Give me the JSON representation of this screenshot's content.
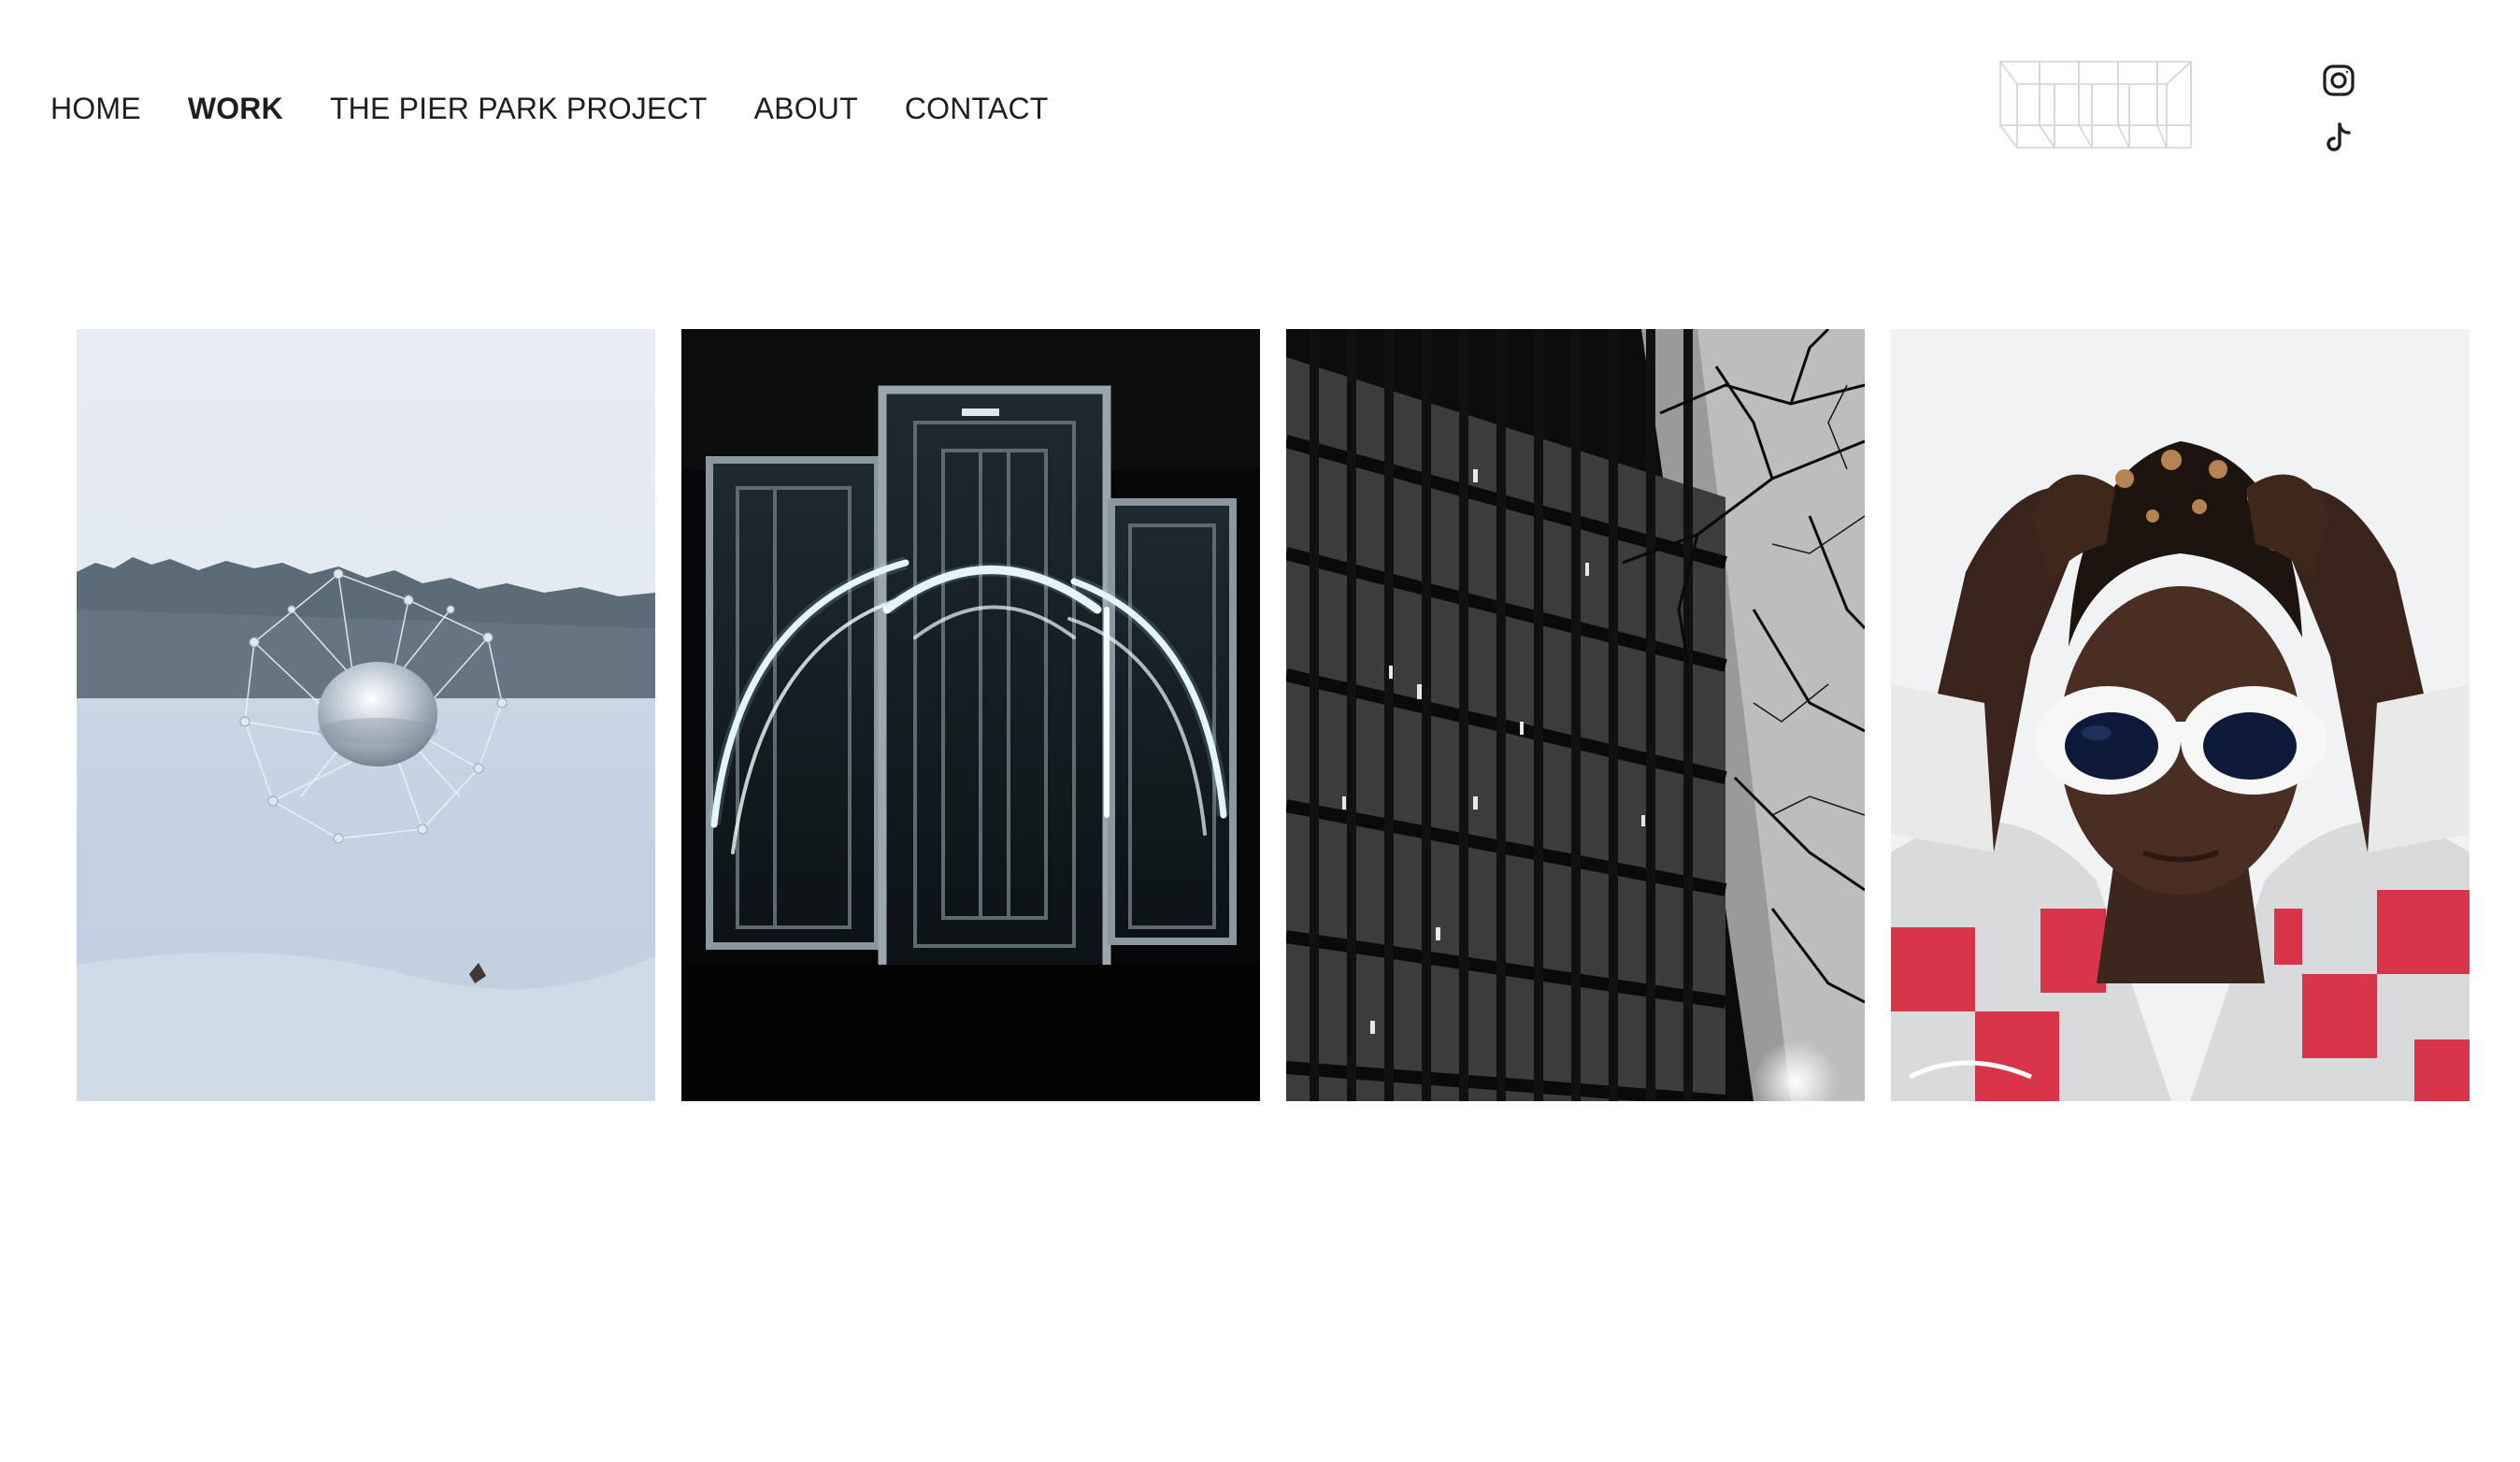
{
  "nav": {
    "items": [
      {
        "label": "HOME",
        "active": false
      },
      {
        "label": "WORK",
        "active": true
      },
      {
        "label": "THE PIER PARK PROJECT",
        "active": false
      },
      {
        "label": "ABOUT",
        "active": false
      },
      {
        "label": "CONTACT",
        "active": false
      }
    ]
  },
  "logo": {
    "icon": "wireframe-boxes-logo"
  },
  "social": [
    {
      "icon": "instagram-icon"
    },
    {
      "icon": "tiktok-icon"
    }
  ],
  "gallery": {
    "tiles": [
      {
        "name": "snow-sphere-sculpture"
      },
      {
        "name": "neon-arch-mirror-installation"
      },
      {
        "name": "building-facade-night"
      },
      {
        "name": "portrait-white-sunglasses"
      }
    ]
  },
  "colors": {
    "text": "#1f1f1f",
    "background": "#ffffff"
  }
}
